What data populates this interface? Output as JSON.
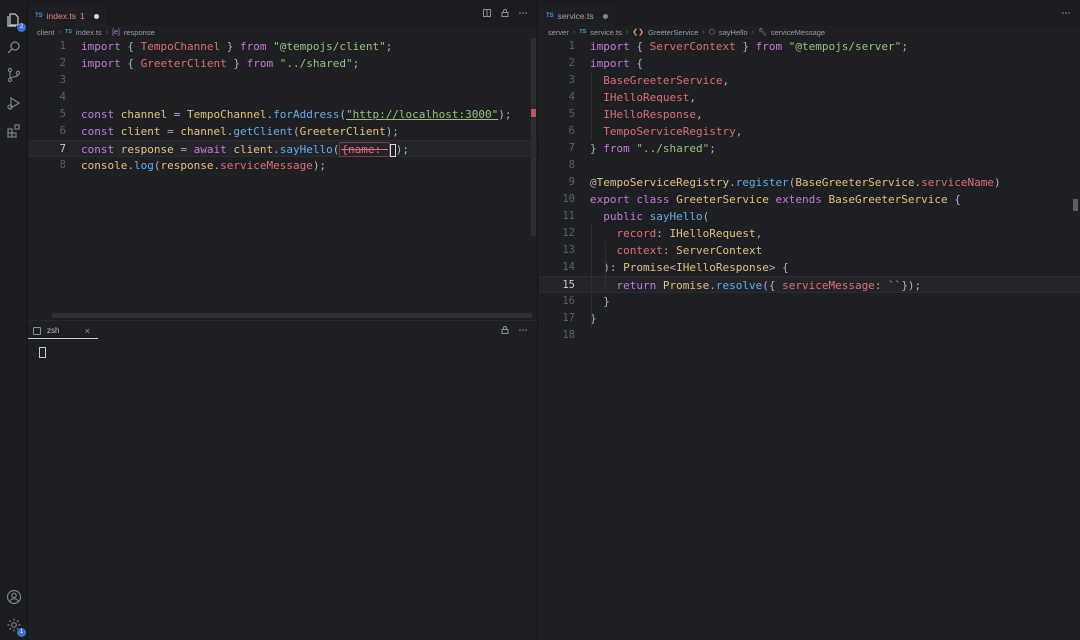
{
  "activity_bar": {
    "explorer_badge": "2",
    "settings_badge": "1"
  },
  "left_editor": {
    "tab": {
      "lang": "TS",
      "filename": "index.ts",
      "problems": "1"
    },
    "breadcrumb": {
      "folder": "client",
      "lang": "TS",
      "file": "index.ts",
      "symbol_icon": "[e]",
      "symbol": "response"
    },
    "lines": [
      {
        "n": "1",
        "tokens": [
          [
            "k",
            "import"
          ],
          [
            "pl",
            " { "
          ],
          [
            "t",
            "TempoChannel"
          ],
          [
            "pl",
            " } "
          ],
          [
            "k",
            "from"
          ],
          [
            "pl",
            " "
          ],
          [
            "s",
            "\"@tempojs/client\""
          ],
          [
            "pl",
            ";"
          ]
        ]
      },
      {
        "n": "2",
        "tokens": [
          [
            "k",
            "import"
          ],
          [
            "pl",
            " { "
          ],
          [
            "t",
            "GreeterClient"
          ],
          [
            "pl",
            " } "
          ],
          [
            "k",
            "from"
          ],
          [
            "pl",
            " "
          ],
          [
            "s",
            "\"../shared\""
          ],
          [
            "pl",
            ";"
          ]
        ]
      },
      {
        "n": "3",
        "tokens": []
      },
      {
        "n": "4",
        "tokens": []
      },
      {
        "n": "5",
        "tokens": [
          [
            "k",
            "const"
          ],
          [
            "pl",
            " "
          ],
          [
            "c",
            "channel"
          ],
          [
            "pl",
            " = "
          ],
          [
            "c",
            "TempoChannel"
          ],
          [
            "pl",
            "."
          ],
          [
            "f",
            "forAddress"
          ],
          [
            "pl",
            "("
          ],
          [
            "su",
            "\"http://localhost:3000\""
          ],
          [
            "pl",
            ");"
          ]
        ]
      },
      {
        "n": "6",
        "tokens": [
          [
            "k",
            "const"
          ],
          [
            "pl",
            " "
          ],
          [
            "c",
            "client"
          ],
          [
            "pl",
            " = "
          ],
          [
            "c",
            "channel"
          ],
          [
            "pl",
            "."
          ],
          [
            "f",
            "getClient"
          ],
          [
            "pl",
            "("
          ],
          [
            "c",
            "GreeterClient"
          ],
          [
            "pl",
            ");"
          ]
        ]
      },
      {
        "n": "7",
        "current": true,
        "tokens": [
          [
            "k",
            "const"
          ],
          [
            "pl",
            " "
          ],
          [
            "c",
            "response"
          ],
          [
            "pl",
            " = "
          ],
          [
            "k",
            "await"
          ],
          [
            "pl",
            " "
          ],
          [
            "c",
            "client"
          ],
          [
            "pl",
            "."
          ],
          [
            "f",
            "sayHello"
          ],
          [
            "pl",
            "("
          ],
          [
            "hint",
            "{name: "
          ],
          [
            "cursor",
            ""
          ],
          [
            "pl",
            ");"
          ]
        ]
      },
      {
        "n": "8",
        "tokens": [
          [
            "c",
            "console"
          ],
          [
            "pl",
            "."
          ],
          [
            "f",
            "log"
          ],
          [
            "pl",
            "("
          ],
          [
            "c",
            "response"
          ],
          [
            "pl",
            "."
          ],
          [
            "t",
            "serviceMessage"
          ],
          [
            "pl",
            ");"
          ]
        ]
      }
    ]
  },
  "right_editor": {
    "tab": {
      "lang": "TS",
      "filename": "service.ts"
    },
    "breadcrumb": {
      "folder": "server",
      "lang": "TS",
      "file": "service.ts",
      "class": "GreeterService",
      "method": "sayHello",
      "prop": "serviceMessage"
    },
    "lines": [
      {
        "n": "1",
        "tokens": [
          [
            "k",
            "import"
          ],
          [
            "pl",
            " { "
          ],
          [
            "t",
            "ServerContext"
          ],
          [
            "pl",
            " } "
          ],
          [
            "k",
            "from"
          ],
          [
            "pl",
            " "
          ],
          [
            "s",
            "\"@tempojs/server\""
          ],
          [
            "pl",
            ";"
          ]
        ]
      },
      {
        "n": "2",
        "tokens": [
          [
            "k",
            "import"
          ],
          [
            "pl",
            " {"
          ]
        ]
      },
      {
        "n": "3",
        "tokens": [
          [
            "pl",
            "  "
          ],
          [
            "t",
            "BaseGreeterService"
          ],
          [
            "pl",
            ","
          ]
        ]
      },
      {
        "n": "4",
        "tokens": [
          [
            "pl",
            "  "
          ],
          [
            "t",
            "IHelloRequest"
          ],
          [
            "pl",
            ","
          ]
        ]
      },
      {
        "n": "5",
        "tokens": [
          [
            "pl",
            "  "
          ],
          [
            "t",
            "IHelloResponse"
          ],
          [
            "pl",
            ","
          ]
        ]
      },
      {
        "n": "6",
        "tokens": [
          [
            "pl",
            "  "
          ],
          [
            "t",
            "TempoServiceRegistry"
          ],
          [
            "pl",
            ","
          ]
        ]
      },
      {
        "n": "7",
        "tokens": [
          [
            "pl",
            "} "
          ],
          [
            "k",
            "from"
          ],
          [
            "pl",
            " "
          ],
          [
            "s",
            "\"../shared\""
          ],
          [
            "pl",
            ";"
          ]
        ]
      },
      {
        "n": "8",
        "tokens": []
      },
      {
        "n": "9",
        "tokens": [
          [
            "pl",
            "@"
          ],
          [
            "c",
            "TempoServiceRegistry"
          ],
          [
            "pl",
            "."
          ],
          [
            "f",
            "register"
          ],
          [
            "pl",
            "("
          ],
          [
            "c",
            "BaseGreeterService"
          ],
          [
            "pl",
            "."
          ],
          [
            "t",
            "serviceName"
          ],
          [
            "pl",
            ")"
          ]
        ]
      },
      {
        "n": "10",
        "tokens": [
          [
            "k",
            "export"
          ],
          [
            "pl",
            " "
          ],
          [
            "k",
            "class"
          ],
          [
            "pl",
            " "
          ],
          [
            "c",
            "GreeterService"
          ],
          [
            "pl",
            " "
          ],
          [
            "k",
            "extends"
          ],
          [
            "pl",
            " "
          ],
          [
            "c",
            "BaseGreeterService"
          ],
          [
            "pl",
            " {"
          ]
        ]
      },
      {
        "n": "11",
        "tokens": [
          [
            "pl",
            "  "
          ],
          [
            "k",
            "public"
          ],
          [
            "pl",
            " "
          ],
          [
            "f",
            "sayHello"
          ],
          [
            "pl",
            "("
          ]
        ]
      },
      {
        "n": "12",
        "tokens": [
          [
            "pl",
            "    "
          ],
          [
            "t",
            "record"
          ],
          [
            "pl",
            ": "
          ],
          [
            "c",
            "IHelloRequest"
          ],
          [
            "pl",
            ","
          ]
        ]
      },
      {
        "n": "13",
        "tokens": [
          [
            "pl",
            "    "
          ],
          [
            "t",
            "context"
          ],
          [
            "pl",
            ": "
          ],
          [
            "c",
            "ServerContext"
          ]
        ]
      },
      {
        "n": "14",
        "tokens": [
          [
            "pl",
            "  ): "
          ],
          [
            "c",
            "Promise"
          ],
          [
            "pl",
            "<"
          ],
          [
            "c",
            "IHelloResponse"
          ],
          [
            "pl",
            "> {"
          ]
        ]
      },
      {
        "n": "15",
        "current": true,
        "tokens": [
          [
            "pl",
            "    "
          ],
          [
            "k",
            "return"
          ],
          [
            "pl",
            " "
          ],
          [
            "c",
            "Promise"
          ],
          [
            "pl",
            "."
          ],
          [
            "f",
            "resolve"
          ],
          [
            "pl",
            "({ "
          ],
          [
            "t",
            "serviceMessage"
          ],
          [
            "pl",
            ": "
          ],
          [
            "s",
            "``"
          ],
          [
            "pl",
            "});"
          ]
        ]
      },
      {
        "n": "16",
        "tokens": [
          [
            "pl",
            "  }"
          ]
        ]
      },
      {
        "n": "17",
        "tokens": [
          [
            "pl",
            "}"
          ]
        ]
      },
      {
        "n": "18",
        "tokens": []
      }
    ]
  },
  "terminal": {
    "tab_label": "zsh"
  },
  "colors": {
    "background": "#1e1f23",
    "keyword": "#c678dd",
    "type": "#e06c75",
    "string": "#98c379",
    "function": "#61afef",
    "accent": "#3b6fd9"
  }
}
